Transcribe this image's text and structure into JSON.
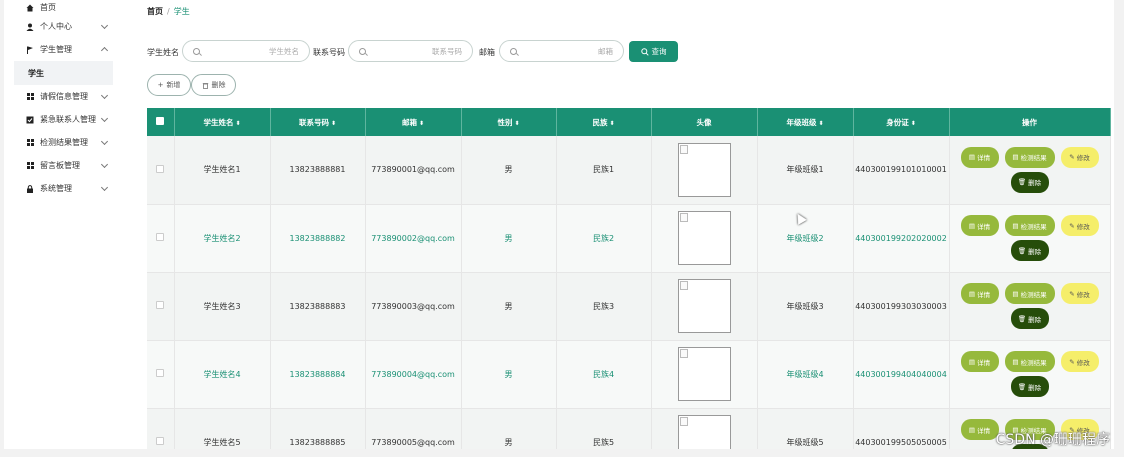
{
  "sidebar": {
    "items": [
      {
        "label": "首页",
        "icon": "home-icon",
        "has_chevron": false
      },
      {
        "label": "个人中心",
        "icon": "user-icon",
        "has_chevron": true
      },
      {
        "label": "学生管理",
        "icon": "flag-icon",
        "has_chevron": true
      },
      {
        "label": "学生",
        "sub": true
      },
      {
        "label": "请假信息管理",
        "icon": "grid-icon",
        "has_chevron": true
      },
      {
        "label": "紧急联系人管理",
        "icon": "check-square-icon",
        "has_chevron": true
      },
      {
        "label": "检测结果管理",
        "icon": "grid-icon",
        "has_chevron": true
      },
      {
        "label": "留言板管理",
        "icon": "grid-icon",
        "has_chevron": true
      },
      {
        "label": "系统管理",
        "icon": "lock-icon",
        "has_chevron": true
      }
    ]
  },
  "breadcrumb": {
    "home": "首页",
    "sep": "/",
    "current": "学生"
  },
  "filters": {
    "name_label": "学生姓名",
    "name_placeholder": "学生姓名",
    "phone_label": "联系号码",
    "phone_placeholder": "联系号码",
    "email_label": "邮箱",
    "email_placeholder": "邮箱",
    "search_label": "查询"
  },
  "actions": {
    "add_label": "新增",
    "delete_label": "删除"
  },
  "table": {
    "headers": [
      "学生姓名",
      "联系号码",
      "邮箱",
      "性别",
      "民族",
      "头像",
      "年级班级",
      "身份证",
      "操作"
    ],
    "rows": [
      {
        "name": "学生姓名1",
        "phone": "13823888881",
        "email": "773890001@qq.com",
        "gender": "男",
        "ethnicity": "民族1",
        "class": "年级班级1",
        "id_card": "440300199101010001"
      },
      {
        "name": "学生姓名2",
        "phone": "13823888882",
        "email": "773890002@qq.com",
        "gender": "男",
        "ethnicity": "民族2",
        "class": "年级班级2",
        "id_card": "440300199202020002"
      },
      {
        "name": "学生姓名3",
        "phone": "13823888883",
        "email": "773890003@qq.com",
        "gender": "男",
        "ethnicity": "民族3",
        "class": "年级班级3",
        "id_card": "440300199303030003"
      },
      {
        "name": "学生姓名4",
        "phone": "13823888884",
        "email": "773890004@qq.com",
        "gender": "男",
        "ethnicity": "民族4",
        "class": "年级班级4",
        "id_card": "440300199404040004"
      },
      {
        "name": "学生姓名5",
        "phone": "13823888885",
        "email": "773890005@qq.com",
        "gender": "男",
        "ethnicity": "民族5",
        "class": "年级班级5",
        "id_card": "440300199505050005"
      }
    ],
    "ops": {
      "detail": "详情",
      "check": "检测结果",
      "edit": "修改",
      "delete": "删除"
    }
  },
  "colors": {
    "accent": "#1a9074",
    "btn_green": "#96b93c",
    "btn_yellow": "#f5ee6a",
    "btn_dark": "#264d0a"
  },
  "watermark": "CSDN @珊珊程序"
}
